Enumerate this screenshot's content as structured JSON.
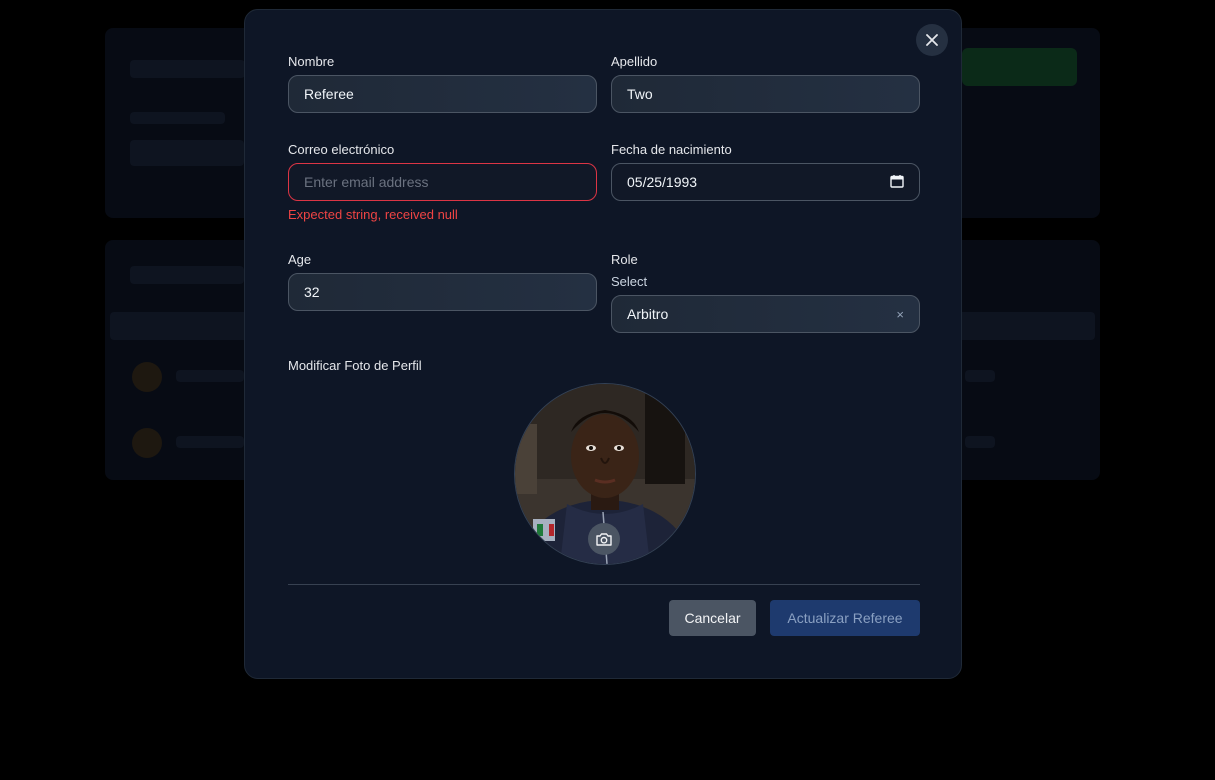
{
  "form": {
    "first_name": {
      "label": "Nombre",
      "value": "Referee"
    },
    "last_name": {
      "label": "Apellido",
      "value": "Two"
    },
    "email": {
      "label": "Correo electrónico",
      "placeholder": "Enter email address",
      "error": "Expected string, received null"
    },
    "birth_date": {
      "label": "Fecha de nacimiento",
      "value": "05/25/1993"
    },
    "age": {
      "label": "Age",
      "value": "32"
    },
    "role": {
      "label": "Role",
      "sublabel": "Select",
      "value": "Arbitro",
      "clear_glyph": "×"
    },
    "photo": {
      "label": "Modificar Foto de Perfil"
    }
  },
  "actions": {
    "cancel_label": "Cancelar",
    "update_label": "Actualizar Referee"
  },
  "icons": {
    "close": "close-icon",
    "calendar": "calendar-icon",
    "camera": "camera-icon"
  },
  "colors": {
    "modal_bg": "#0e1626",
    "error": "#ef4444",
    "primary_button": "#1e3a6e",
    "secondary_button": "#4b5563"
  }
}
